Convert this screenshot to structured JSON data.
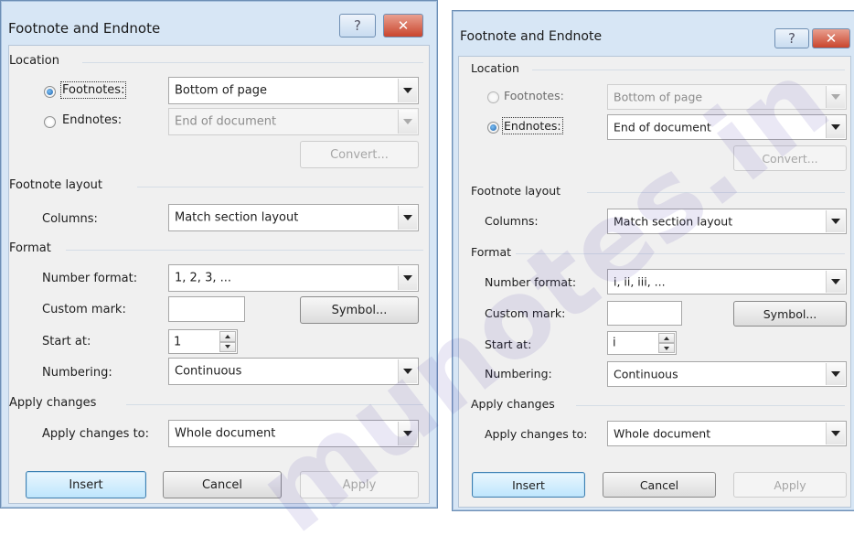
{
  "dialog_left": {
    "title": "Footnote and Endnote",
    "help_glyph": "?",
    "close_glyph": "✕",
    "location_label": "Location",
    "footnotes_label": "Footnotes:",
    "footnotes_value": "Bottom of page",
    "endnotes_label": "Endnotes:",
    "endnotes_value": "End of document",
    "convert_label": "Convert...",
    "footnote_layout_label": "Footnote layout",
    "columns_label": "Columns:",
    "columns_value": "Match section layout",
    "format_label": "Format",
    "number_format_label": "Number format:",
    "number_format_value": "1, 2, 3, ...",
    "custom_mark_label": "Custom mark:",
    "custom_mark_value": "",
    "symbol_label": "Symbol...",
    "start_at_label": "Start at:",
    "start_at_value": "1",
    "numbering_label": "Numbering:",
    "numbering_value": "Continuous",
    "apply_changes_label": "Apply changes",
    "apply_changes_to_label": "Apply changes to:",
    "apply_changes_to_value": "Whole document",
    "insert_label": "Insert",
    "cancel_label": "Cancel",
    "apply_label": "Apply",
    "selected_option": "Footnotes"
  },
  "dialog_right": {
    "title": "Footnote and Endnote",
    "help_glyph": "?",
    "close_glyph": "✕",
    "location_label": "Location",
    "footnotes_label": "Footnotes:",
    "footnotes_value": "Bottom of page",
    "endnotes_label": "Endnotes:",
    "endnotes_value": "End of document",
    "convert_label": "Convert...",
    "footnote_layout_label": "Footnote layout",
    "columns_label": "Columns:",
    "columns_value": "Match section layout",
    "format_label": "Format",
    "number_format_label": "Number format:",
    "number_format_value": "i, ii, iii, ...",
    "custom_mark_label": "Custom mark:",
    "custom_mark_value": "",
    "symbol_label": "Symbol...",
    "start_at_label": "Start at:",
    "start_at_value": "i",
    "numbering_label": "Numbering:",
    "numbering_value": "Continuous",
    "apply_changes_label": "Apply changes",
    "apply_changes_to_label": "Apply changes to:",
    "apply_changes_to_value": "Whole document",
    "insert_label": "Insert",
    "cancel_label": "Cancel",
    "apply_label": "Apply",
    "selected_option": "Endnotes"
  },
  "watermark": "munotes.in",
  "colors": {
    "titlebar": "#d7e6f5",
    "dialog_body": "#f0f0f0",
    "close_button": "#c9452d",
    "default_button": "#3c7fb1",
    "watermark": "#4a3aa8"
  }
}
